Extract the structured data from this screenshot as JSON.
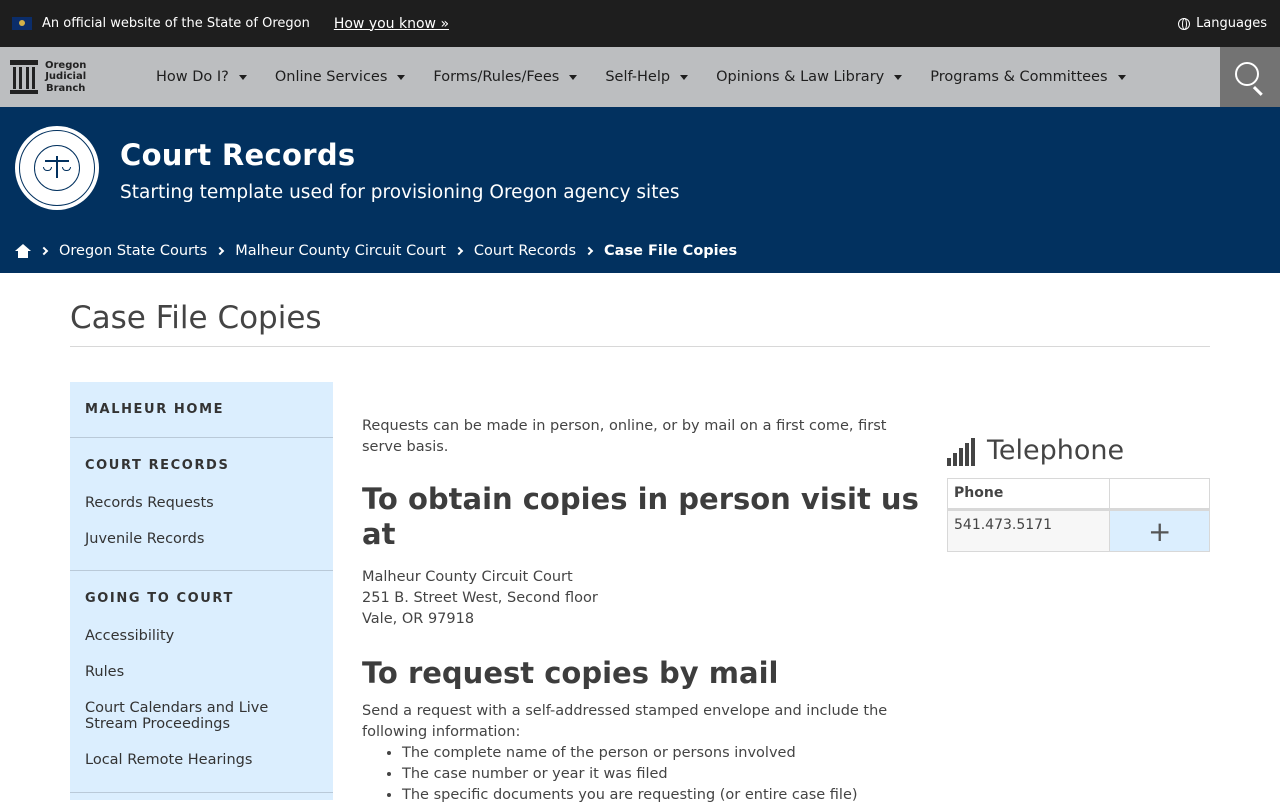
{
  "official_bar": {
    "text": "An official website of the State of Oregon",
    "how_link": "How you know »",
    "languages": "Languages"
  },
  "logo": {
    "line1": "Oregon",
    "line2": "Judicial",
    "line3": "Branch"
  },
  "nav": {
    "items": [
      {
        "label": "How Do I?"
      },
      {
        "label": "Online Services"
      },
      {
        "label": "Forms/Rules/Fees"
      },
      {
        "label": "Self-Help"
      },
      {
        "label": "Opinions & Law Library"
      },
      {
        "label": "Programs & Committees"
      }
    ]
  },
  "header": {
    "title": "Court Records",
    "tagline": "Starting template used for provisioning Oregon agency sites"
  },
  "breadcrumb": {
    "items": [
      "Oregon State Courts",
      "Malheur County Circuit Court",
      "Court Records"
    ],
    "current": "Case File Copies"
  },
  "page": {
    "title": "Case File Copies"
  },
  "sidebar": {
    "sections": [
      {
        "heading": "MALHEUR HOME",
        "links": []
      },
      {
        "heading": "COURT RECORDS",
        "links": [
          "Records Requests",
          "Juvenile Records"
        ]
      },
      {
        "heading": "GOING TO COURT",
        "links": [
          "Accessibility",
          "Rules",
          "Court Calendars and Live Stream Proceedings",
          "Local Remote Hearings"
        ]
      }
    ]
  },
  "content": {
    "intro": "Requests can be made in person, online, or by mail on a first come, first serve basis.",
    "obtain_heading": "To obtain copies in person visit us at",
    "address": [
      "Malheur County Circuit Court",
      "251 B. Street West, Second floor",
      "Vale, OR 97918"
    ],
    "mail_heading": "To request copies by mail",
    "mail_text": "Send a request with a self-addressed stamped envelope and include the following information:",
    "mail_list": [
      "The complete name of the person or persons involved",
      "The case number or year it was filed",
      "The specific documents you are requesting (or entire case file)"
    ]
  },
  "telephone": {
    "title": "Telephone",
    "col1": "Phone",
    "col2": "",
    "number": "541.473.5171",
    "expand": "+"
  }
}
